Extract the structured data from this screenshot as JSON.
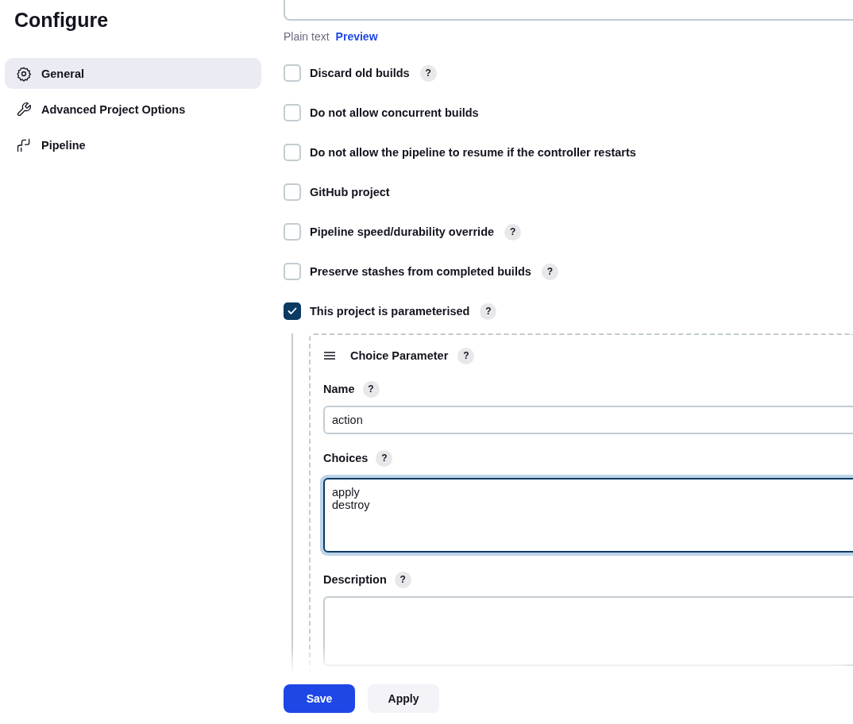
{
  "sidebar": {
    "title": "Configure",
    "items": [
      {
        "label": "General",
        "selected": true
      },
      {
        "label": "Advanced Project Options",
        "selected": false
      },
      {
        "label": "Pipeline",
        "selected": false
      }
    ]
  },
  "description_editor": {
    "modes": [
      {
        "label": "Plain text",
        "kind": "plain"
      },
      {
        "label": "Preview",
        "kind": "link"
      }
    ]
  },
  "options": [
    {
      "label": "Discard old builds",
      "checked": false,
      "help": "?"
    },
    {
      "label": "Do not allow concurrent builds",
      "checked": false
    },
    {
      "label": "Do not allow the pipeline to resume if the controller restarts",
      "checked": false
    },
    {
      "label": "GitHub project",
      "checked": false
    },
    {
      "label": "Pipeline speed/durability override",
      "checked": false,
      "help": "?"
    },
    {
      "label": "Preserve stashes from completed builds",
      "checked": false,
      "help": "?"
    },
    {
      "label": "This project is parameterised",
      "checked": true,
      "help": "?"
    }
  ],
  "parameter": {
    "title": "Choice Parameter",
    "help": "?",
    "fields": [
      {
        "label": "Name",
        "help": "?",
        "kind": "input",
        "value": "action"
      },
      {
        "label": "Choices",
        "help": "?",
        "kind": "textarea",
        "value": "apply\ndestroy",
        "focused": true
      },
      {
        "label": "Description",
        "help": "?",
        "kind": "textarea"
      }
    ]
  },
  "buttons": [
    {
      "label": "Save",
      "kind": "primary"
    },
    {
      "label": "Apply",
      "kind": "secondary"
    }
  ]
}
